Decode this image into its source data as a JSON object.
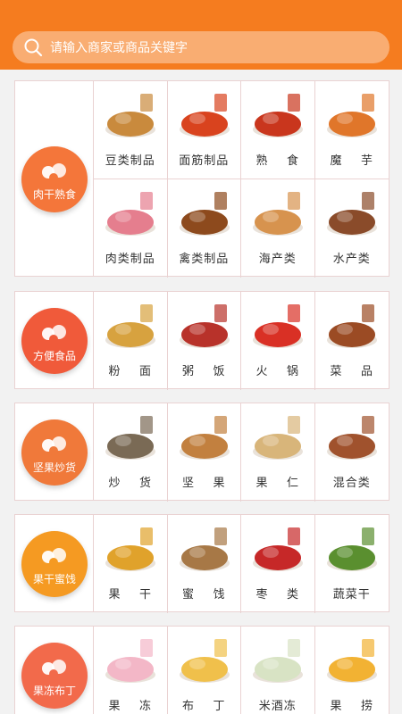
{
  "search": {
    "placeholder": "请输入商家或商品关键字"
  },
  "sections": [
    {
      "name": "肉干熟食",
      "badge_color": "#f4763a",
      "badge_icon": "meat-icon",
      "items": [
        {
          "label": "豆类制品",
          "icon": "tofu-snack-icon",
          "color": "#c98a3d"
        },
        {
          "label": "面筋制品",
          "icon": "spicy-strip-icon",
          "color": "#d9431e"
        },
        {
          "label": "熟    食",
          "icon": "cooked-food-icon",
          "color": "#c9361d"
        },
        {
          "label": "魔    芋",
          "icon": "konjac-icon",
          "color": "#e0762a"
        },
        {
          "label": "肉类制品",
          "icon": "ham-icon",
          "color": "#e57e8e"
        },
        {
          "label": "禽类制品",
          "icon": "poultry-icon",
          "color": "#8d4a1d"
        },
        {
          "label": "海产类",
          "icon": "seafood-icon",
          "color": "#d7934e"
        },
        {
          "label": "水产类",
          "icon": "fish-snack-icon",
          "color": "#8a4b2a"
        }
      ]
    },
    {
      "name": "方便食品",
      "badge_color": "#f05a3a",
      "badge_icon": "noodle-bowl-icon",
      "items": [
        {
          "label": "粉    面",
          "icon": "noodles-icon",
          "color": "#d7a23f"
        },
        {
          "label": "粥    饭",
          "icon": "rice-porridge-icon",
          "color": "#b8322a"
        },
        {
          "label": "火    锅",
          "icon": "hotpot-icon",
          "color": "#d93025"
        },
        {
          "label": "菜    品",
          "icon": "dish-icon",
          "color": "#9b4b24"
        }
      ]
    },
    {
      "name": "坚果炒货",
      "badge_color": "#f0793a",
      "badge_icon": "seed-icon",
      "items": [
        {
          "label": "炒    货",
          "icon": "sunflower-seeds-icon",
          "color": "#7a6a55"
        },
        {
          "label": "坚    果",
          "icon": "almond-icon",
          "color": "#c2803f"
        },
        {
          "label": "果    仁",
          "icon": "cashew-icon",
          "color": "#d8b57a"
        },
        {
          "label": "混合类",
          "icon": "mixed-nuts-icon",
          "color": "#a0522d"
        }
      ]
    },
    {
      "name": "果干蜜饯",
      "badge_color": "#f59a22",
      "badge_icon": "leaf-icon",
      "items": [
        {
          "label": "果    干",
          "icon": "dried-fruit-icon",
          "color": "#e0a22b"
        },
        {
          "label": "蜜    饯",
          "icon": "candied-fruit-icon",
          "color": "#a77846"
        },
        {
          "label": "枣    类",
          "icon": "jujube-icon",
          "color": "#c62828"
        },
        {
          "label": "蔬菜干",
          "icon": "dried-veg-icon",
          "color": "#5a8f2f"
        }
      ]
    },
    {
      "name": "果冻布丁",
      "badge_color": "#f26a4b",
      "badge_icon": "pudding-icon",
      "items": [
        {
          "label": "果    冻",
          "icon": "jelly-icon",
          "color": "#f3b7c7"
        },
        {
          "label": "布    丁",
          "icon": "pudding-cup-icon",
          "color": "#f0c04b"
        },
        {
          "label": "米酒冻",
          "icon": "rice-wine-jelly-icon",
          "color": "#d8e3c4"
        },
        {
          "label": "果    捞",
          "icon": "fruit-cup-icon",
          "color": "#f2b233"
        }
      ]
    }
  ]
}
